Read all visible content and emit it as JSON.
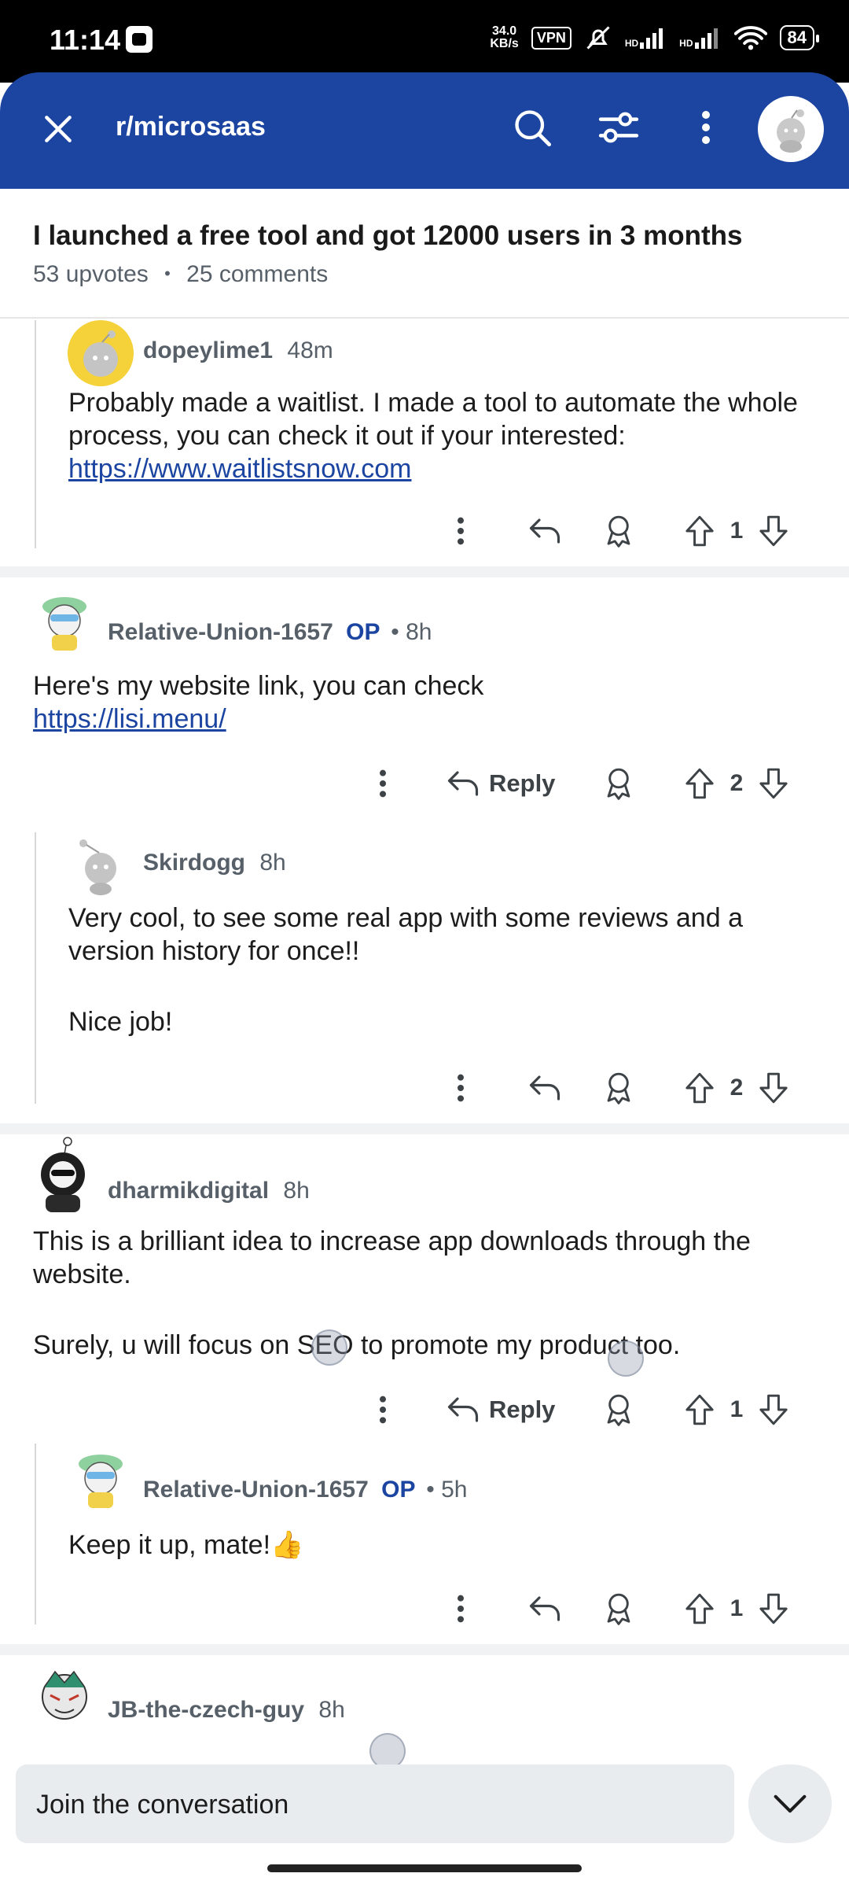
{
  "status_bar": {
    "time": "11:14",
    "net_speed_value": "34.0",
    "net_speed_unit": "KB/s",
    "vpn": "VPN",
    "hd1": "HD",
    "hd2": "HD",
    "battery": "84"
  },
  "header": {
    "subreddit": "r/microsaas",
    "close_icon": "close-icon",
    "search_icon": "search-icon",
    "filter_icon": "sort-filter-icon",
    "more_icon": "more-vertical-icon"
  },
  "post": {
    "title": "I launched a free tool and got 12000 users in 3 months",
    "upvotes": "53 upvotes",
    "dot": "•",
    "comments": "25 comments"
  },
  "comments": [
    {
      "author": "dopeylime1",
      "op": "",
      "age": "48m",
      "body": [
        "Probably made a waitlist. I made a tool to automate the whole process, you can check it out if your interested:"
      ],
      "link": "https://www.waitlistsnow.com",
      "votes": "1",
      "reply_label": ""
    },
    {
      "author": "Relative-Union-1657",
      "op": "OP",
      "age": "• 8h",
      "body": [
        "Here's my website link, you can check"
      ],
      "link": "https://lisi.menu/",
      "votes": "2",
      "reply_label": "Reply"
    },
    {
      "author": "Skirdogg",
      "op": "",
      "age": "8h",
      "body": [
        "Very cool, to see some real app with some reviews and a version history for once!!",
        "Nice job!"
      ],
      "votes": "2",
      "reply_label": ""
    },
    {
      "author": "dharmikdigital",
      "op": "",
      "age": "8h",
      "body": [
        "This is a brilliant idea to increase app downloads through the website.",
        "Surely, u will focus on SEO to promote my product too."
      ],
      "votes": "1",
      "reply_label": "Reply"
    },
    {
      "author": "Relative-Union-1657",
      "op": "OP",
      "age": "• 5h",
      "body": [
        "Keep it up, mate!👍"
      ],
      "votes": "1",
      "reply_label": ""
    },
    {
      "author": "JB-the-czech-guy",
      "op": "",
      "age": "8h"
    }
  ],
  "bottom": {
    "join_placeholder": "Join the conversation",
    "collapse_icon": "chevron-down-icon"
  },
  "colors": {
    "header_blue": "#1b45a1",
    "link_blue": "#1b45a1",
    "meta_gray": "#576069"
  }
}
